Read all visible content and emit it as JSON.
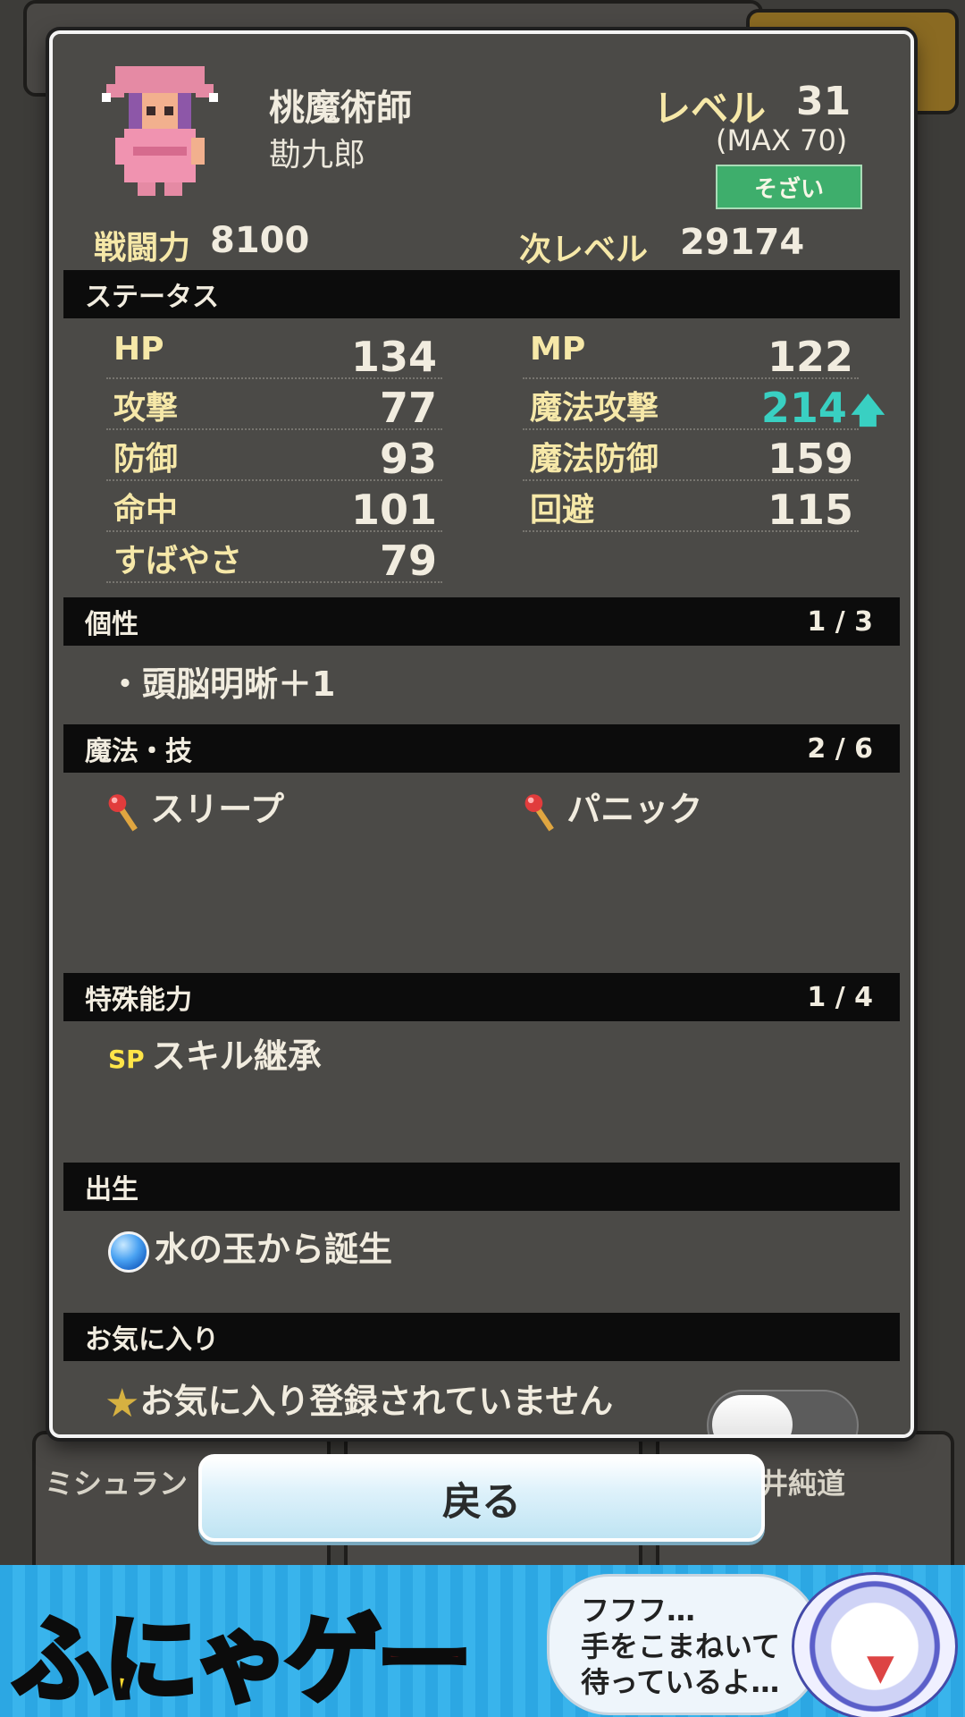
{
  "character": {
    "job": "桃魔術師",
    "name": "勘九郎",
    "level_label": "レベル",
    "level": "31",
    "level_max": "(MAX 70)",
    "sozai_label": "そざい",
    "power_label": "戦闘力",
    "power": "8100",
    "next_label": "次レベル",
    "next": "29174"
  },
  "sections": {
    "status": "ステータス",
    "traits": "個性",
    "traits_count": "1 / 3",
    "skills": "魔法・技",
    "skills_count": "2 / 6",
    "special": "特殊能力",
    "special_count": "1 / 4",
    "origin": "出生",
    "favorite": "お気に入り"
  },
  "stats": {
    "left": [
      {
        "name": "HP",
        "value": "134"
      },
      {
        "name": "攻撃",
        "value": "77"
      },
      {
        "name": "防御",
        "value": "93"
      },
      {
        "name": "命中",
        "value": "101"
      },
      {
        "name": "すばやさ",
        "value": "79"
      }
    ],
    "right": [
      {
        "name": "MP",
        "value": "122"
      },
      {
        "name": "魔法攻撃",
        "value": "214"
      },
      {
        "name": "魔法防御",
        "value": "159"
      },
      {
        "name": "回避",
        "value": "115"
      }
    ],
    "boost_arrow": "🡅",
    "boost_color": "#39d0c2"
  },
  "traits": [
    "・頭脳明晰＋1"
  ],
  "skills": [
    "スリープ",
    "パニック"
  ],
  "special": {
    "badge": "SP",
    "label": "スキル継承"
  },
  "origin": {
    "label": "水の玉から誕生"
  },
  "favorite": {
    "label": "お気に入り登録されていません",
    "enabled": false
  },
  "back_button": "戻る",
  "background_names": [
    "ミシュラン",
    "井純道"
  ],
  "ad": {
    "logo_a": "ふにゃ",
    "logo_b": "ゲー",
    "lines": [
      "フフフ…",
      "手をこまねいて",
      "待っているよ…"
    ]
  },
  "colors": {
    "gold_label": "#f6e8a8",
    "panel": "#4b4a47",
    "section_bar": "#0c0c0c",
    "sozai_green": "#3eae6c"
  }
}
